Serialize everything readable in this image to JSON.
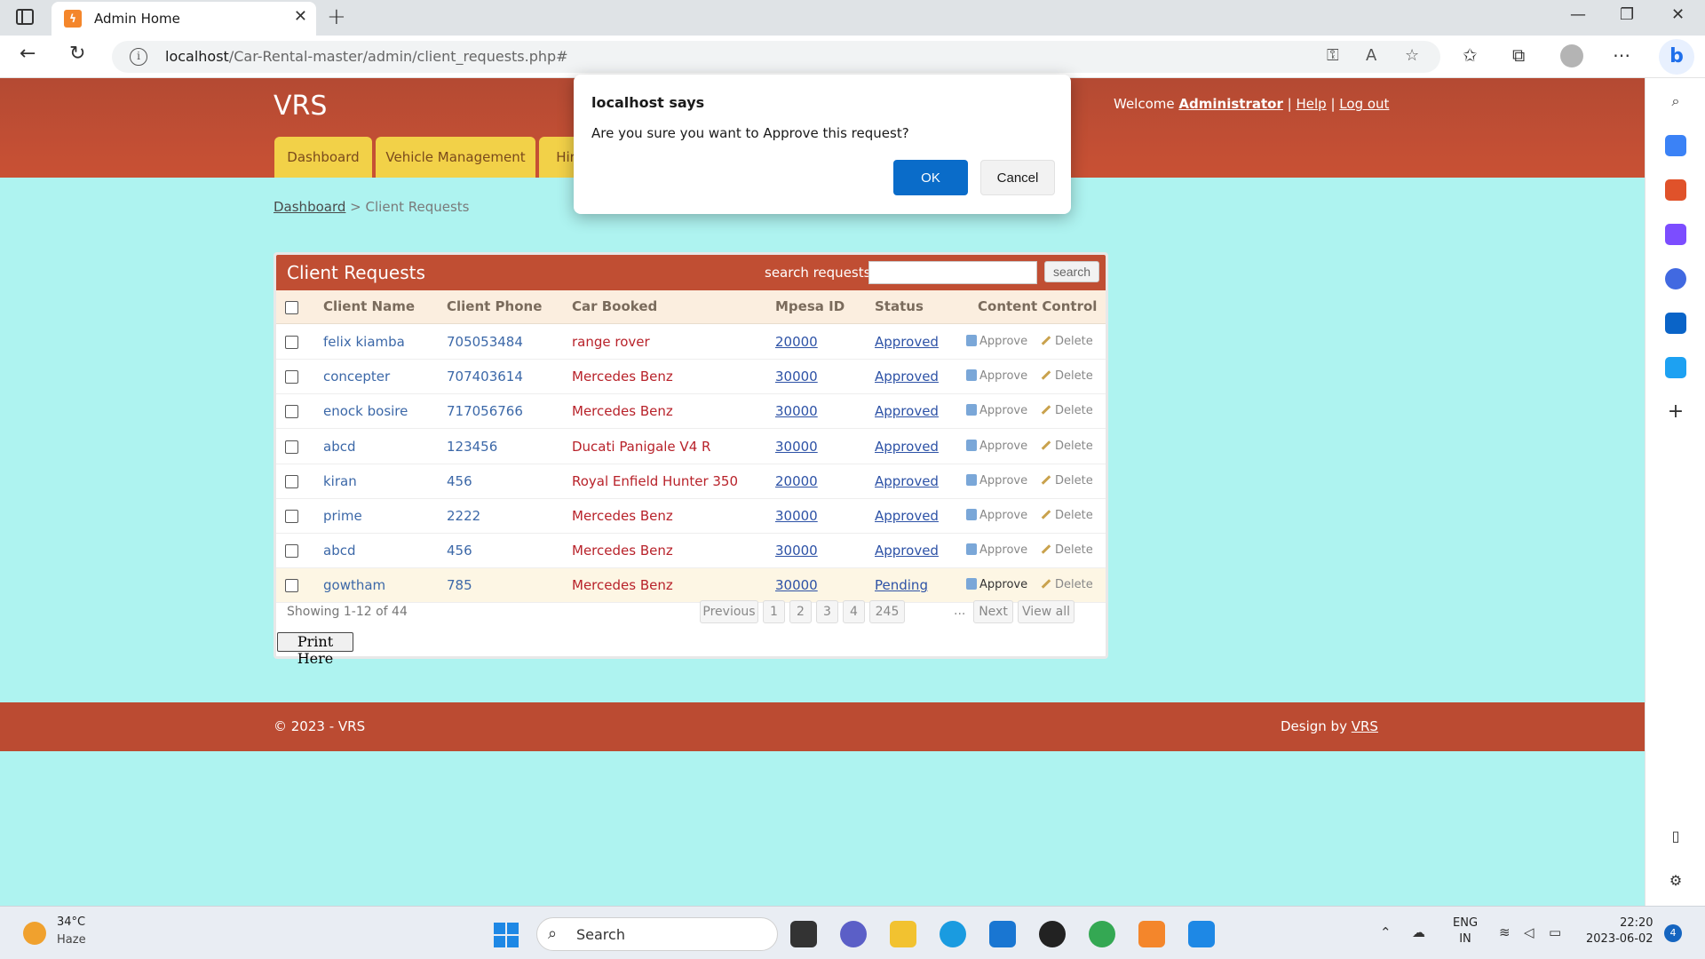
{
  "browser": {
    "tab_title": "Admin Home",
    "tab_favicon": "XAMPP",
    "url_host": "localhost",
    "url_path": "/Car-Rental-master/admin/client_requests.php#"
  },
  "site": {
    "brand": "VRS",
    "welcome_text": "Welcome",
    "user": "Administrator",
    "help": "Help",
    "logout": "Log out",
    "separator": "|",
    "nav": [
      "Dashboard",
      "Vehicle Management",
      "Hir"
    ]
  },
  "breadcrumb": {
    "home": "Dashboard",
    "sep": ">",
    "current": "Client Requests"
  },
  "panel": {
    "title": "Client Requests",
    "search_label": "search requests",
    "search_value": "",
    "search_button": "search",
    "columns": [
      "Client Name",
      "Client Phone",
      "Car Booked",
      "Mpesa ID",
      "Status",
      "Content Control"
    ],
    "approve_label": "Approve",
    "delete_label": "Delete",
    "rows": [
      {
        "name": "felix kiamba",
        "phone": "705053484",
        "car": "range rover",
        "mpesa": "20000",
        "status": "Approved"
      },
      {
        "name": "concepter",
        "phone": "707403614",
        "car": "Mercedes Benz",
        "mpesa": "30000",
        "status": "Approved"
      },
      {
        "name": "enock bosire",
        "phone": "717056766",
        "car": "Mercedes Benz",
        "mpesa": "30000",
        "status": "Approved"
      },
      {
        "name": "abcd",
        "phone": "123456",
        "car": "Ducati Panigale V4 R",
        "mpesa": "30000",
        "status": "Approved"
      },
      {
        "name": "kiran",
        "phone": "456",
        "car": "Royal Enfield Hunter 350",
        "mpesa": "20000",
        "status": "Approved"
      },
      {
        "name": "prime",
        "phone": "2222",
        "car": "Mercedes Benz",
        "mpesa": "30000",
        "status": "Approved"
      },
      {
        "name": "abcd",
        "phone": "456",
        "car": "Mercedes Benz",
        "mpesa": "30000",
        "status": "Approved"
      },
      {
        "name": "gowtham",
        "phone": "785",
        "car": "Mercedes Benz",
        "mpesa": "30000",
        "status": "Pending"
      }
    ],
    "showing": "Showing 1-12 of 44",
    "pagination": {
      "previous": "Previous",
      "pages": [
        "1",
        "2",
        "3",
        "4",
        "245"
      ],
      "ellipsis": "...",
      "next": "Next",
      "view_all": "View all"
    },
    "print_button": "Print Here"
  },
  "footer": {
    "copyright": "© 2023 - VRS",
    "design_by": "Design by",
    "design_link": "VRS"
  },
  "dialog": {
    "title": "localhost says",
    "message": "Are you sure you want to Approve this request?",
    "ok": "OK",
    "cancel": "Cancel"
  },
  "taskbar": {
    "temperature": "34°C",
    "weather": "Haze",
    "search_placeholder": "Search",
    "lang_top": "ENG",
    "lang_bottom": "IN",
    "time": "22:20",
    "date": "2023-06-02",
    "notification_count": "4"
  },
  "colors": {
    "header": "#c04e33",
    "page_bg": "#aef3f0",
    "nav_tab": "#f2d148",
    "ok_button": "#0a6cc9"
  }
}
